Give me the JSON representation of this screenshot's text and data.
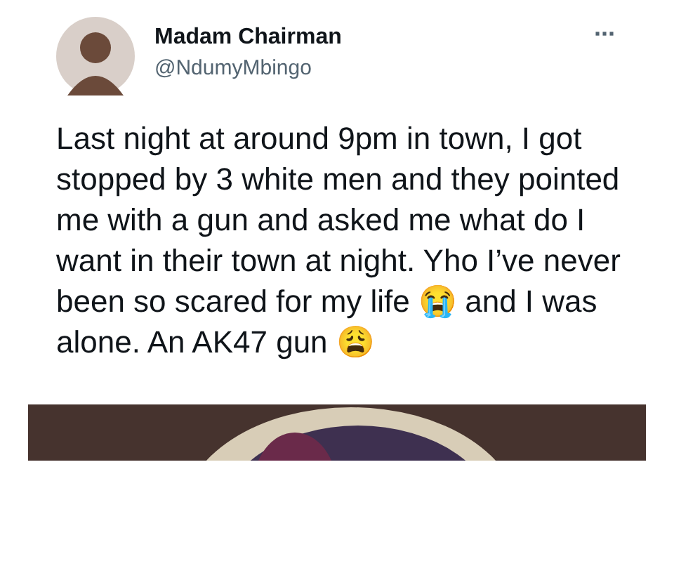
{
  "tweet": {
    "author_name": "Madam Chairman",
    "handle": "@NdumyMbingo",
    "more": "···",
    "text": "Last night at around 9pm in town, I got stopped by 3 white men and they pointed me with a gun and asked me what do I want in their town at night. Yho I’ve never been so scared for my life 😭 and I was alone. An AK47 gun 😩"
  }
}
